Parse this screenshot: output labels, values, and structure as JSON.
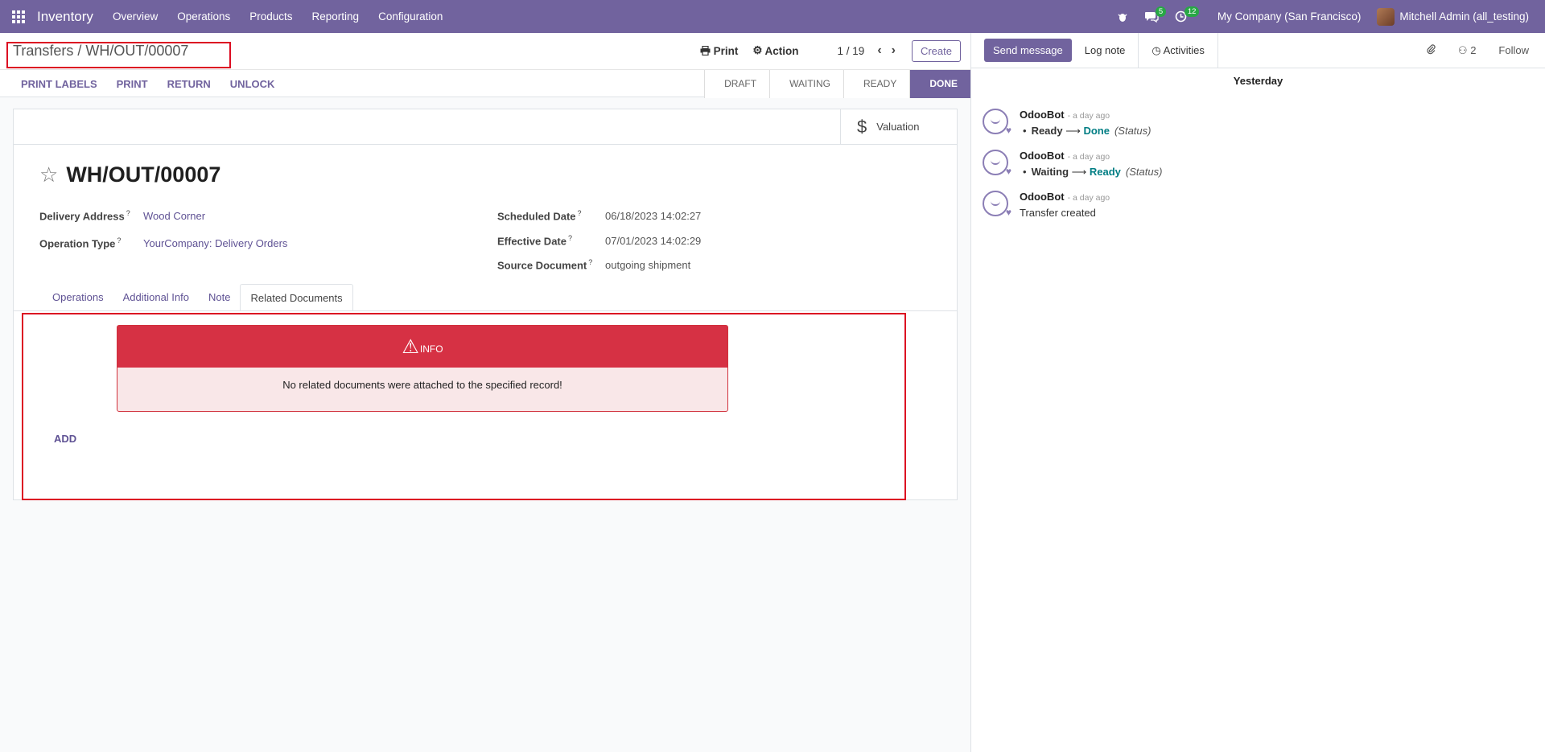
{
  "navbar": {
    "brand": "Inventory",
    "menu": [
      "Overview",
      "Operations",
      "Products",
      "Reporting",
      "Configuration"
    ],
    "messages_count": "5",
    "activities_count": "12",
    "company": "My Company (San Francisco)",
    "user": "Mitchell Admin (all_testing)"
  },
  "control": {
    "breadcrumb": "Transfers / WH/OUT/00007",
    "print_label": "Print",
    "action_label": "Action",
    "pager": "1 / 19",
    "create_label": "Create",
    "sub_actions": [
      "PRINT LABELS",
      "PRINT",
      "RETURN",
      "UNLOCK"
    ],
    "stages": [
      "DRAFT",
      "WAITING",
      "READY",
      "DONE"
    ]
  },
  "form": {
    "valuation_label": "Valuation",
    "title": "WH/OUT/00007",
    "delivery_address_label": "Delivery Address",
    "delivery_address": "Wood Corner",
    "operation_type_label": "Operation Type",
    "operation_type": "YourCompany: Delivery Orders",
    "scheduled_date_label": "Scheduled Date",
    "scheduled_date": "06/18/2023 14:02:27",
    "effective_date_label": "Effective Date",
    "effective_date": "07/01/2023 14:02:29",
    "source_document_label": "Source Document",
    "source_document": "outgoing shipment",
    "help_mark": "?",
    "tabs": [
      "Operations",
      "Additional Info",
      "Note",
      "Related Documents"
    ],
    "alert_title": "INFO",
    "alert_message": "No related documents were attached to the specified record!",
    "add_label": "ADD"
  },
  "chatter": {
    "send_message": "Send message",
    "log_note": "Log note",
    "activities": "Activities",
    "followers_count": "2",
    "follow": "Follow",
    "day_label": "Yesterday",
    "messages": [
      {
        "author": "OdooBot",
        "date": "- a day ago",
        "old": "Ready",
        "new": "Done",
        "field": "(Status)"
      },
      {
        "author": "OdooBot",
        "date": "- a day ago",
        "old": "Waiting",
        "new": "Ready",
        "field": "(Status)"
      },
      {
        "author": "OdooBot",
        "date": "- a day ago",
        "text": "Transfer created"
      }
    ]
  }
}
